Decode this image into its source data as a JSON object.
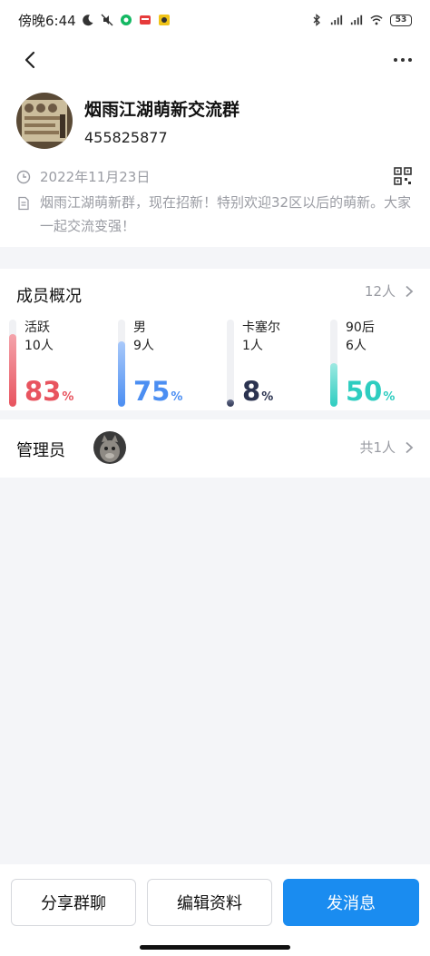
{
  "status_bar": {
    "time": "傍晚6:44",
    "battery": "53"
  },
  "group": {
    "name": "烟雨江湖萌新交流群",
    "id": "455825877",
    "date": "2022年11月23日",
    "description": "烟雨江湖萌新群，现在招新！特别欢迎32区以后的萌新。大家一起交流变强！"
  },
  "members": {
    "title": "成员概况",
    "count": "12人",
    "stats": [
      {
        "label": "活跃",
        "sub": "10人",
        "percent": 83,
        "percent_text": "83",
        "color": "#e8545f",
        "color_light": "#f4a4ab"
      },
      {
        "label": "男",
        "sub": "9人",
        "percent": 75,
        "percent_text": "75",
        "color": "#4b8ef2",
        "color_light": "#a9c9fa"
      },
      {
        "label": "卡塞尔",
        "sub": "1人",
        "percent": 8,
        "percent_text": "8",
        "color": "#2b3350",
        "color_light": "#6b7390"
      },
      {
        "label": "90后",
        "sub": "6人",
        "percent": 50,
        "percent_text": "50",
        "color": "#2ecdc0",
        "color_light": "#9ee9e2"
      }
    ],
    "percent_symbol": "%"
  },
  "admin": {
    "title": "管理员",
    "count": "共1人"
  },
  "buttons": {
    "share": "分享群聊",
    "edit": "编辑资料",
    "message": "发消息"
  },
  "colors": {
    "primary": "#1a8cf0",
    "muted": "#9a9ca3"
  }
}
